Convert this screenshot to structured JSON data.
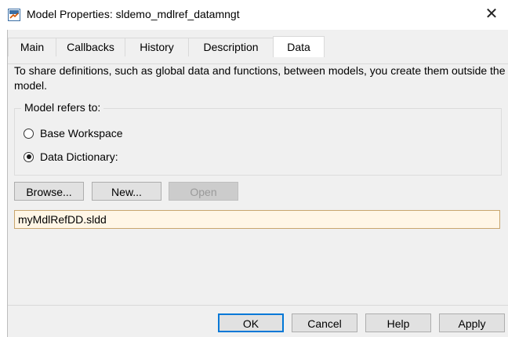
{
  "window": {
    "title": "Model Properties: sldemo_mdlref_datamngt",
    "close_glyph": "✕",
    "app_icon": "simulink-model-icon"
  },
  "tabs": [
    {
      "label": "Main",
      "active": false
    },
    {
      "label": "Callbacks",
      "active": false
    },
    {
      "label": "History",
      "active": false
    },
    {
      "label": "Description",
      "active": false
    },
    {
      "label": "Data",
      "active": true
    }
  ],
  "data_tab": {
    "description": "To share definitions, such as global data and functions, between models, you create them outside the model.",
    "group_label": "Model refers to:",
    "options": [
      {
        "label": "Base Workspace",
        "checked": false
      },
      {
        "label": "Data Dictionary:",
        "checked": true
      }
    ],
    "buttons": {
      "browse": "Browse...",
      "new": "New...",
      "open": "Open"
    },
    "dictionary_value": "myMdlRefDD.sldd"
  },
  "footer": {
    "ok": "OK",
    "cancel": "Cancel",
    "help": "Help",
    "apply": "Apply"
  },
  "colors": {
    "field_background": "#fff6e6",
    "default_button_border": "#0078d7"
  }
}
